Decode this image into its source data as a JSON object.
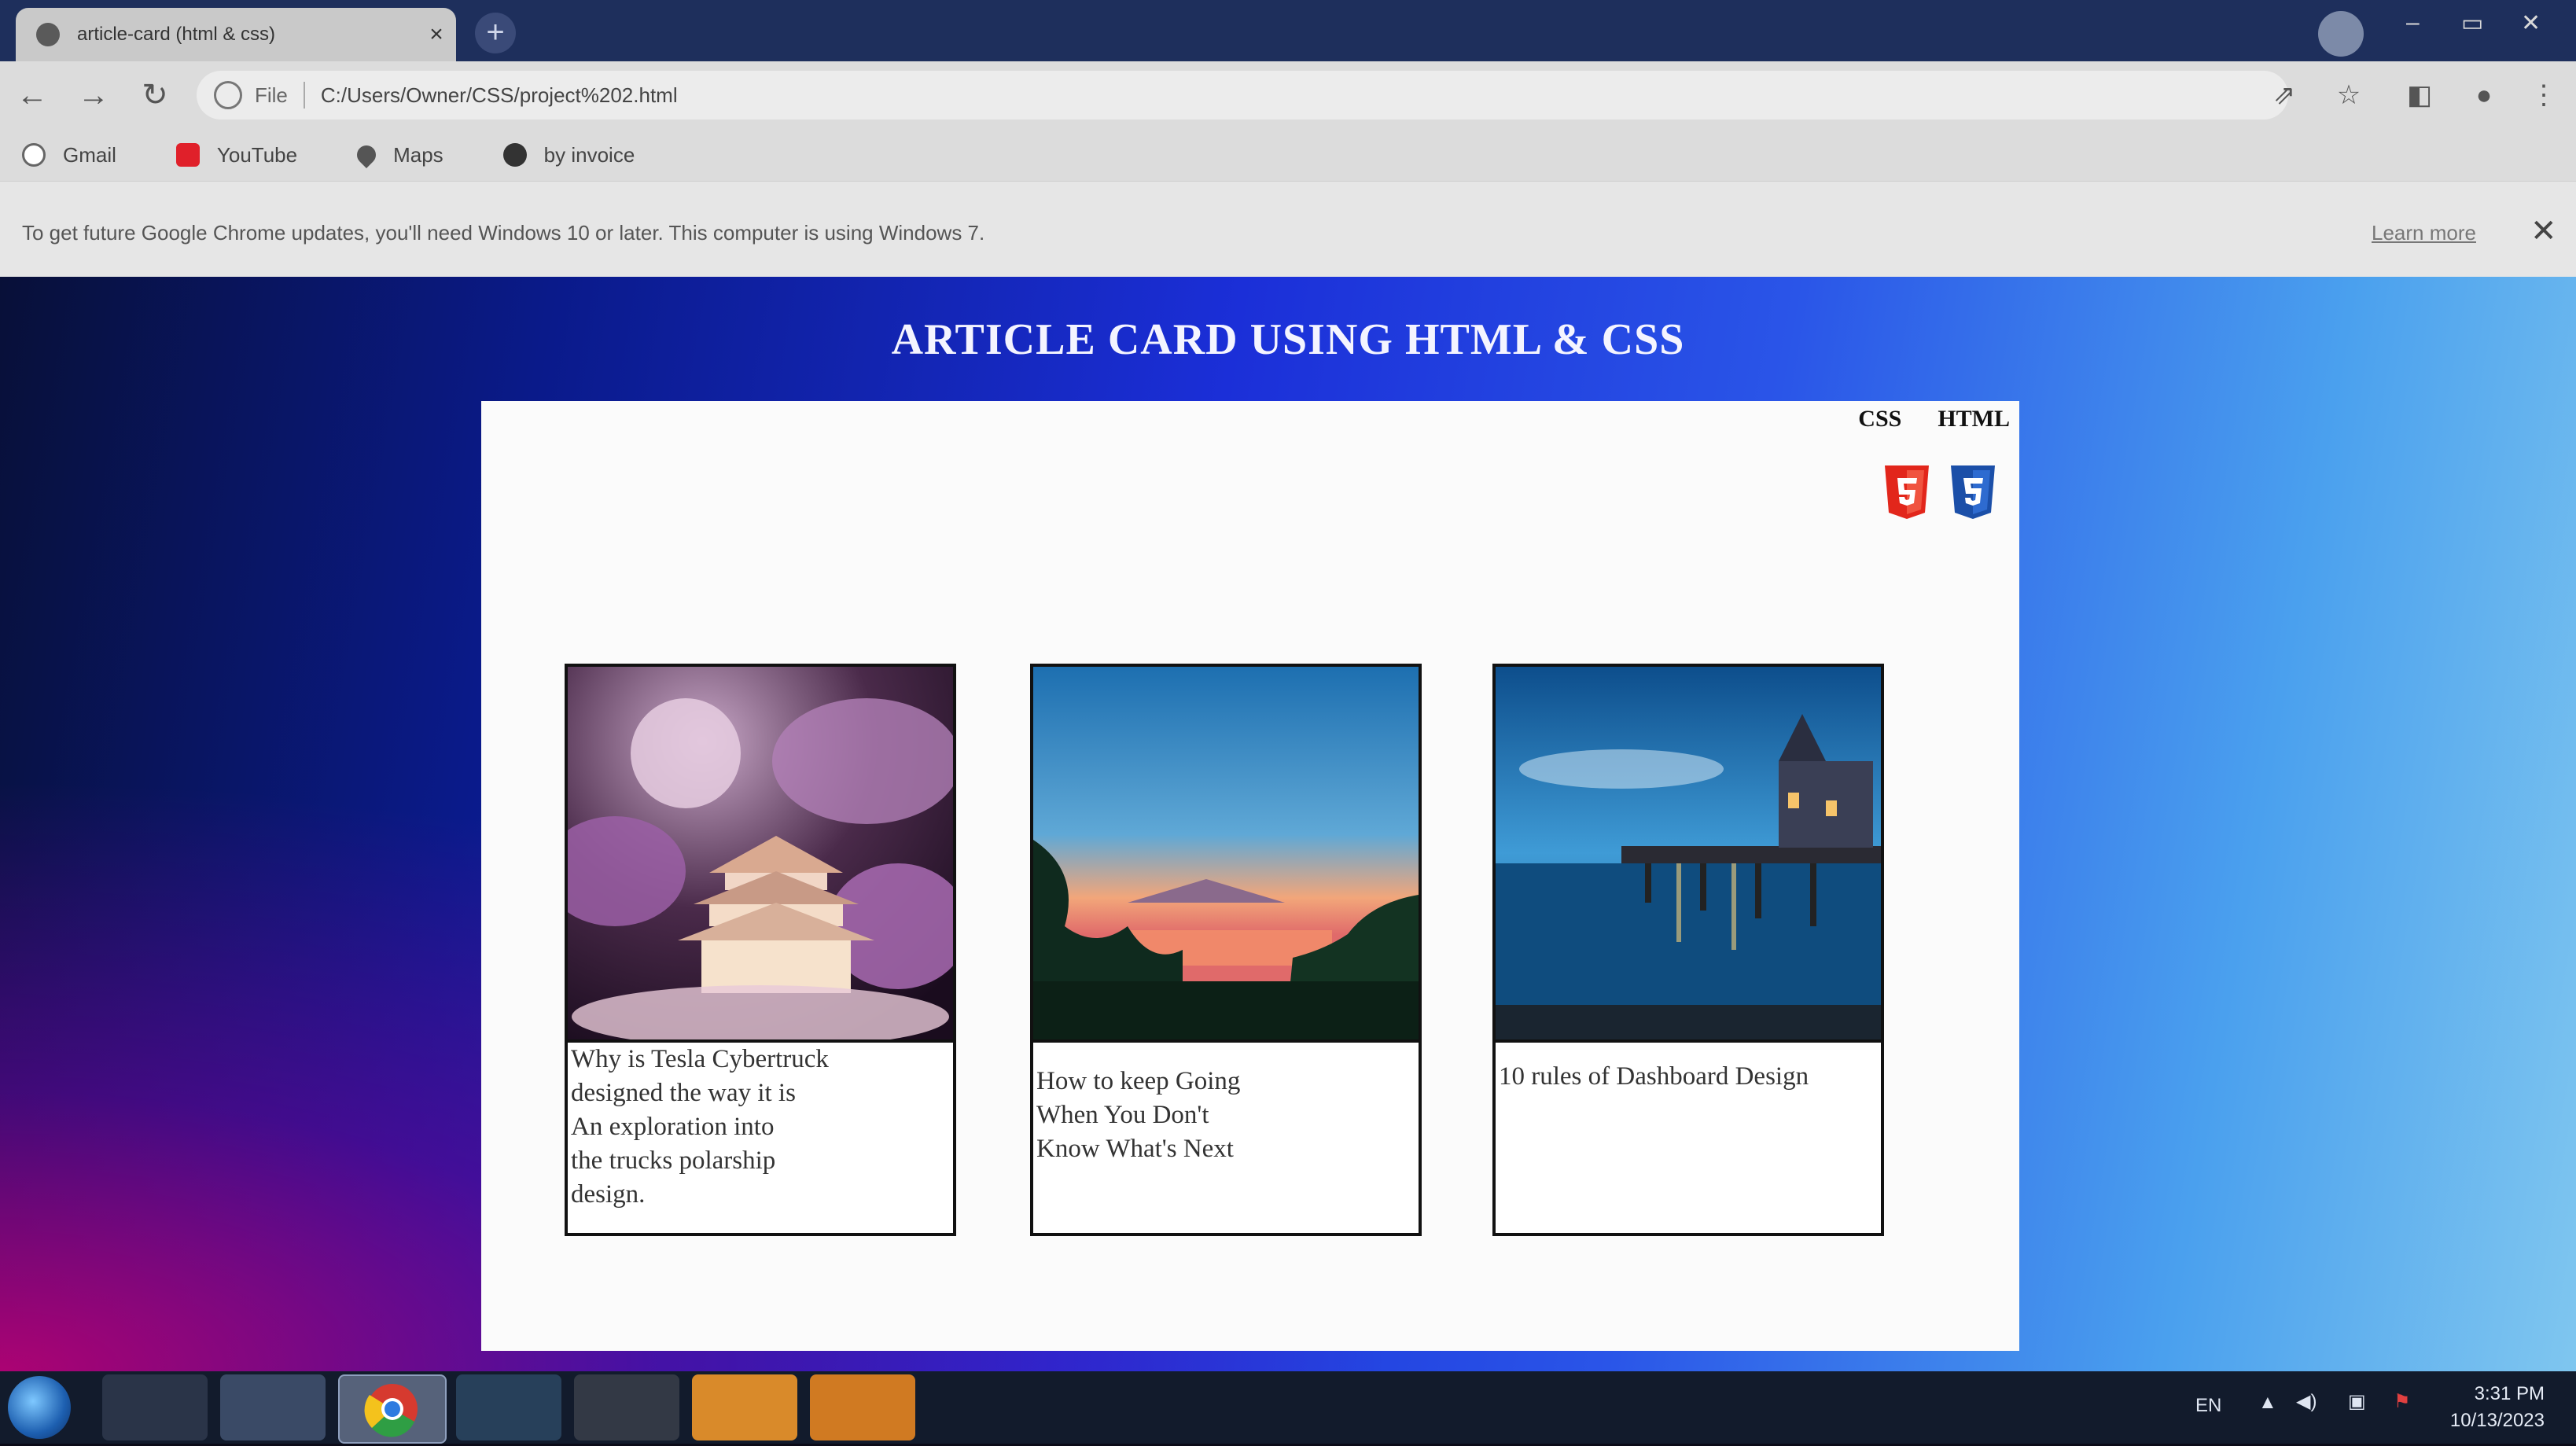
{
  "browser": {
    "tab_title": "article-card (html & css)",
    "omnibox": {
      "scheme": "File",
      "url": "C:/Users/Owner/CSS/project%202.html"
    },
    "bookmarks": [
      {
        "label": "Gmail",
        "icon": "google-icon"
      },
      {
        "label": "YouTube",
        "icon": "youtube-icon"
      },
      {
        "label": "Maps",
        "icon": "maps-pin-icon"
      },
      {
        "label": "by invoice",
        "icon": "globe-icon"
      }
    ],
    "infobar": {
      "message": "To get future Google Chrome updates, you'll need Windows 10 or later. This computer is using Windows 7.",
      "link": "Learn more"
    }
  },
  "page": {
    "heading": "ARTICLE CARD USING HTML & CSS",
    "lang_labels": [
      "CSS",
      "HTML"
    ],
    "cards": [
      {
        "text": "Why is Tesla Cybertruck\ndesigned the way it is\nAn exploration into\nthe trucks polarship\ndesign."
      },
      {
        "text": "How to keep Going\nWhen You Don't\nKnow What's Next"
      },
      {
        "text": "10 rules of Dashboard Design"
      }
    ]
  },
  "taskbar": {
    "language": "EN",
    "time": "3:31 PM",
    "date": "10/13/2023"
  },
  "colors": {
    "html5_badge": "#e2261b",
    "css3_badge": "#1b4fa8",
    "heading": "#f4f4ff"
  }
}
